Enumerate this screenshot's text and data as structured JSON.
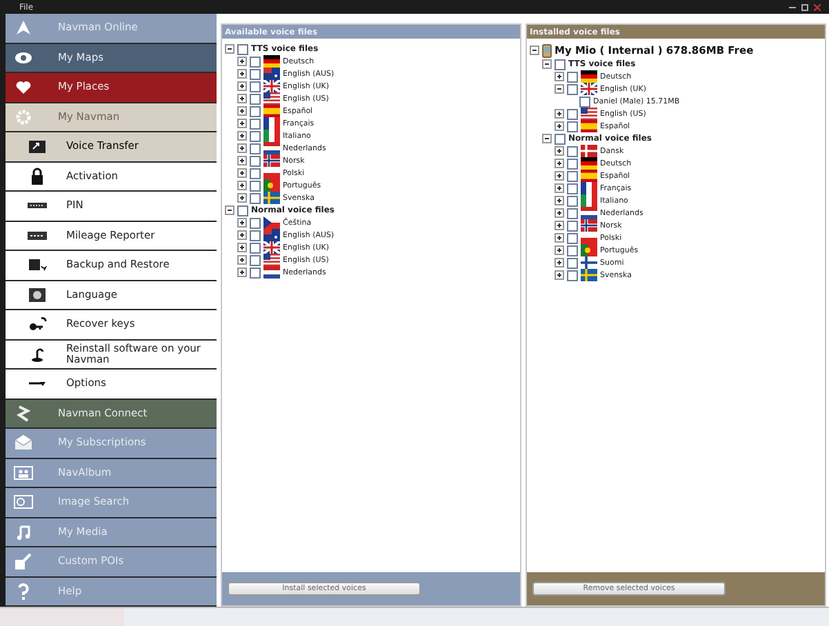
{
  "menu": [
    "File"
  ],
  "sidebar": [
    {
      "kind": "section",
      "label": "Navman Online",
      "color": "#8a9cb8"
    },
    {
      "kind": "section",
      "label": "My Maps",
      "color": "#4d6176"
    },
    {
      "kind": "section",
      "label": "My Places",
      "color": "#9a1b1f"
    },
    {
      "kind": "section",
      "label": "My Navman",
      "color": "#d6cfc3"
    },
    {
      "kind": "sub",
      "label": "Voice Transfer",
      "selected": true
    },
    {
      "kind": "sub",
      "label": "Activation",
      "selected": false
    },
    {
      "kind": "sub",
      "label": "PIN",
      "selected": false
    },
    {
      "kind": "sub",
      "label": "Mileage Reporter",
      "selected": false
    },
    {
      "kind": "sub",
      "label": "Backup and Restore",
      "selected": false
    },
    {
      "kind": "sub",
      "label": "Language",
      "selected": false
    },
    {
      "kind": "sub",
      "label": "Recover keys",
      "selected": false
    },
    {
      "kind": "sub",
      "label": "Reinstall software on your Navman",
      "selected": false
    },
    {
      "kind": "sub",
      "label": "Options",
      "selected": false
    },
    {
      "kind": "section",
      "label": "Navman Connect",
      "color": "#5d6c5a"
    },
    {
      "kind": "section",
      "label": "My Subscriptions",
      "color": "#8a9cb8"
    },
    {
      "kind": "section",
      "label": "NavAlbum",
      "color": "#8a9cb8"
    },
    {
      "kind": "section",
      "label": "Image Search",
      "color": "#8a9cb8"
    },
    {
      "kind": "section",
      "label": "My Media",
      "color": "#8a9cb8"
    },
    {
      "kind": "section",
      "label": "Custom POIs",
      "color": "#8a9cb8"
    },
    {
      "kind": "section",
      "label": "Help",
      "color": "#8a9cb8"
    }
  ],
  "available": {
    "title": "Available voice files",
    "button": "Install selected voices",
    "tree": [
      {
        "label": "TTS voice files",
        "checked": false,
        "expanded": true,
        "children": [
          {
            "label": "Deutsch",
            "checked": false,
            "expanded": false
          },
          {
            "label": "English (AUS)",
            "checked": false,
            "expanded": false
          },
          {
            "label": "English (UK)",
            "checked": false,
            "expanded": false
          },
          {
            "label": "English (US)",
            "checked": false,
            "expanded": false
          },
          {
            "label": "Español",
            "checked": false,
            "expanded": false
          },
          {
            "label": "Français",
            "checked": false,
            "expanded": false
          },
          {
            "label": "Italiano",
            "checked": false,
            "expanded": false
          },
          {
            "label": "Nederlands",
            "checked": false,
            "expanded": false
          },
          {
            "label": "Norsk",
            "checked": false,
            "expanded": false
          },
          {
            "label": "Polski",
            "checked": false,
            "expanded": false
          },
          {
            "label": "Português",
            "checked": false,
            "expanded": false
          },
          {
            "label": "Svenska",
            "checked": false,
            "expanded": false
          }
        ]
      },
      {
        "label": "Normal voice files",
        "checked": false,
        "expanded": true,
        "children": [
          {
            "label": "Čeština",
            "checked": false,
            "expanded": false
          },
          {
            "label": "English (AUS)",
            "checked": false,
            "expanded": false
          },
          {
            "label": "English (UK)",
            "checked": false,
            "expanded": false
          },
          {
            "label": "English (US)",
            "checked": false,
            "expanded": false
          },
          {
            "label": "Nederlands",
            "checked": false,
            "expanded": false
          }
        ]
      }
    ]
  },
  "installed": {
    "title": "Installed voice files",
    "button": "Remove selected voices",
    "device": "My Mio ( Internal ) 678.86MB Free",
    "device_expanded": true,
    "tree": [
      {
        "label": "TTS voice files",
        "checked": false,
        "expanded": true,
        "children": [
          {
            "label": "Deutsch",
            "checked": false,
            "expanded": false
          },
          {
            "label": "English (UK)",
            "checked": false,
            "expanded": true,
            "children": [
              {
                "label": "Daniel (Male) 15.71MB",
                "checked": false
              }
            ]
          },
          {
            "label": "English (US)",
            "checked": false,
            "expanded": false
          },
          {
            "label": "Español",
            "checked": false,
            "expanded": false
          }
        ]
      },
      {
        "label": "Normal voice files",
        "checked": false,
        "expanded": true,
        "children": [
          {
            "label": "Dansk",
            "checked": false,
            "expanded": false
          },
          {
            "label": "Deutsch",
            "checked": false,
            "expanded": false
          },
          {
            "label": "Español",
            "checked": false,
            "expanded": false
          },
          {
            "label": "Français",
            "checked": false,
            "expanded": false
          },
          {
            "label": "Italiano",
            "checked": false,
            "expanded": false
          },
          {
            "label": "Nederlands",
            "checked": false,
            "expanded": false
          },
          {
            "label": "Norsk",
            "checked": false,
            "expanded": false
          },
          {
            "label": "Polski",
            "checked": false,
            "expanded": false
          },
          {
            "label": "Português",
            "checked": false,
            "expanded": false
          },
          {
            "label": "Suomi",
            "checked": false,
            "expanded": false
          },
          {
            "label": "Svenska",
            "checked": false,
            "expanded": false
          }
        ]
      }
    ]
  }
}
